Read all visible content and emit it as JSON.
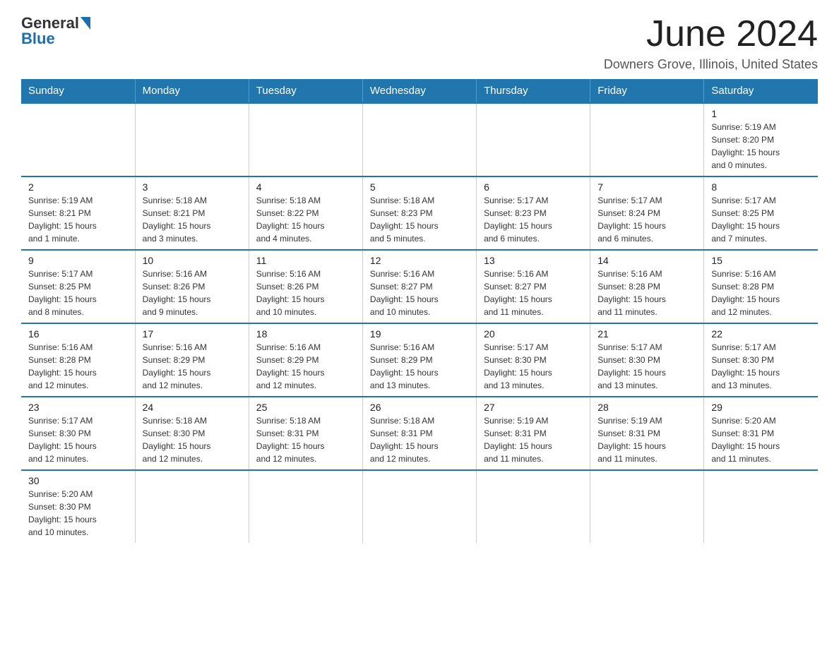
{
  "logo": {
    "general": "General",
    "blue": "Blue"
  },
  "header": {
    "title": "June 2024",
    "subtitle": "Downers Grove, Illinois, United States"
  },
  "days_of_week": [
    "Sunday",
    "Monday",
    "Tuesday",
    "Wednesday",
    "Thursday",
    "Friday",
    "Saturday"
  ],
  "weeks": [
    [
      {
        "day": "",
        "info": ""
      },
      {
        "day": "",
        "info": ""
      },
      {
        "day": "",
        "info": ""
      },
      {
        "day": "",
        "info": ""
      },
      {
        "day": "",
        "info": ""
      },
      {
        "day": "",
        "info": ""
      },
      {
        "day": "1",
        "info": "Sunrise: 5:19 AM\nSunset: 8:20 PM\nDaylight: 15 hours\nand 0 minutes."
      }
    ],
    [
      {
        "day": "2",
        "info": "Sunrise: 5:19 AM\nSunset: 8:21 PM\nDaylight: 15 hours\nand 1 minute."
      },
      {
        "day": "3",
        "info": "Sunrise: 5:18 AM\nSunset: 8:21 PM\nDaylight: 15 hours\nand 3 minutes."
      },
      {
        "day": "4",
        "info": "Sunrise: 5:18 AM\nSunset: 8:22 PM\nDaylight: 15 hours\nand 4 minutes."
      },
      {
        "day": "5",
        "info": "Sunrise: 5:18 AM\nSunset: 8:23 PM\nDaylight: 15 hours\nand 5 minutes."
      },
      {
        "day": "6",
        "info": "Sunrise: 5:17 AM\nSunset: 8:23 PM\nDaylight: 15 hours\nand 6 minutes."
      },
      {
        "day": "7",
        "info": "Sunrise: 5:17 AM\nSunset: 8:24 PM\nDaylight: 15 hours\nand 6 minutes."
      },
      {
        "day": "8",
        "info": "Sunrise: 5:17 AM\nSunset: 8:25 PM\nDaylight: 15 hours\nand 7 minutes."
      }
    ],
    [
      {
        "day": "9",
        "info": "Sunrise: 5:17 AM\nSunset: 8:25 PM\nDaylight: 15 hours\nand 8 minutes."
      },
      {
        "day": "10",
        "info": "Sunrise: 5:16 AM\nSunset: 8:26 PM\nDaylight: 15 hours\nand 9 minutes."
      },
      {
        "day": "11",
        "info": "Sunrise: 5:16 AM\nSunset: 8:26 PM\nDaylight: 15 hours\nand 10 minutes."
      },
      {
        "day": "12",
        "info": "Sunrise: 5:16 AM\nSunset: 8:27 PM\nDaylight: 15 hours\nand 10 minutes."
      },
      {
        "day": "13",
        "info": "Sunrise: 5:16 AM\nSunset: 8:27 PM\nDaylight: 15 hours\nand 11 minutes."
      },
      {
        "day": "14",
        "info": "Sunrise: 5:16 AM\nSunset: 8:28 PM\nDaylight: 15 hours\nand 11 minutes."
      },
      {
        "day": "15",
        "info": "Sunrise: 5:16 AM\nSunset: 8:28 PM\nDaylight: 15 hours\nand 12 minutes."
      }
    ],
    [
      {
        "day": "16",
        "info": "Sunrise: 5:16 AM\nSunset: 8:28 PM\nDaylight: 15 hours\nand 12 minutes."
      },
      {
        "day": "17",
        "info": "Sunrise: 5:16 AM\nSunset: 8:29 PM\nDaylight: 15 hours\nand 12 minutes."
      },
      {
        "day": "18",
        "info": "Sunrise: 5:16 AM\nSunset: 8:29 PM\nDaylight: 15 hours\nand 12 minutes."
      },
      {
        "day": "19",
        "info": "Sunrise: 5:16 AM\nSunset: 8:29 PM\nDaylight: 15 hours\nand 13 minutes."
      },
      {
        "day": "20",
        "info": "Sunrise: 5:17 AM\nSunset: 8:30 PM\nDaylight: 15 hours\nand 13 minutes."
      },
      {
        "day": "21",
        "info": "Sunrise: 5:17 AM\nSunset: 8:30 PM\nDaylight: 15 hours\nand 13 minutes."
      },
      {
        "day": "22",
        "info": "Sunrise: 5:17 AM\nSunset: 8:30 PM\nDaylight: 15 hours\nand 13 minutes."
      }
    ],
    [
      {
        "day": "23",
        "info": "Sunrise: 5:17 AM\nSunset: 8:30 PM\nDaylight: 15 hours\nand 12 minutes."
      },
      {
        "day": "24",
        "info": "Sunrise: 5:18 AM\nSunset: 8:30 PM\nDaylight: 15 hours\nand 12 minutes."
      },
      {
        "day": "25",
        "info": "Sunrise: 5:18 AM\nSunset: 8:31 PM\nDaylight: 15 hours\nand 12 minutes."
      },
      {
        "day": "26",
        "info": "Sunrise: 5:18 AM\nSunset: 8:31 PM\nDaylight: 15 hours\nand 12 minutes."
      },
      {
        "day": "27",
        "info": "Sunrise: 5:19 AM\nSunset: 8:31 PM\nDaylight: 15 hours\nand 11 minutes."
      },
      {
        "day": "28",
        "info": "Sunrise: 5:19 AM\nSunset: 8:31 PM\nDaylight: 15 hours\nand 11 minutes."
      },
      {
        "day": "29",
        "info": "Sunrise: 5:20 AM\nSunset: 8:31 PM\nDaylight: 15 hours\nand 11 minutes."
      }
    ],
    [
      {
        "day": "30",
        "info": "Sunrise: 5:20 AM\nSunset: 8:30 PM\nDaylight: 15 hours\nand 10 minutes."
      },
      {
        "day": "",
        "info": ""
      },
      {
        "day": "",
        "info": ""
      },
      {
        "day": "",
        "info": ""
      },
      {
        "day": "",
        "info": ""
      },
      {
        "day": "",
        "info": ""
      },
      {
        "day": "",
        "info": ""
      }
    ]
  ]
}
